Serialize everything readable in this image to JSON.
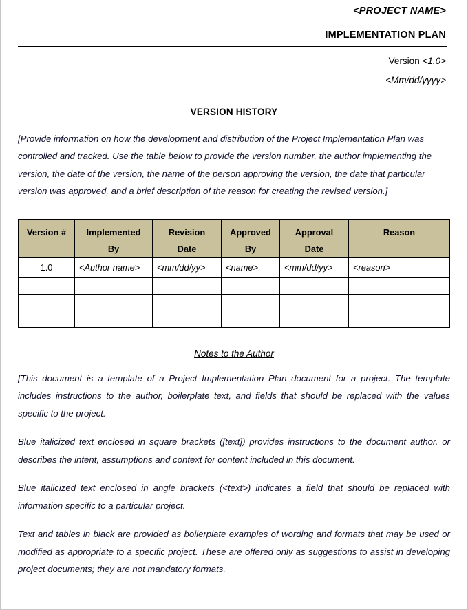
{
  "document": {
    "project_name": "<PROJECT NAME>",
    "title": "IMPLEMENTATION PLAN",
    "version_label": "Version ",
    "version_value": "<1.0>",
    "date": "<Mm/dd/yyyy>"
  },
  "version_history": {
    "heading": "VERSION HISTORY",
    "intro": "[Provide information on how the development and distribution of the Project Implementation Plan was controlled and tracked.  Use the table below to provide the version number, the author implementing the version, the date of the version, the name of the person approving the version, the date that particular version was approved, and a brief description of the reason for creating the revised version.]",
    "table": {
      "headers": [
        "Version #",
        "Implemented\nBy",
        "Revision\nDate",
        "Approved\nBy",
        "Approval\nDate",
        "Reason"
      ],
      "header_lines": [
        [
          "Version #",
          ""
        ],
        [
          "Implemented",
          "By"
        ],
        [
          "Revision",
          "Date"
        ],
        [
          "Approved",
          "By"
        ],
        [
          "Approval",
          "Date"
        ],
        [
          "Reason",
          ""
        ]
      ],
      "rows": [
        [
          "1.0",
          "<Author name>",
          "<mm/dd/yy>",
          "<name>",
          "<mm/dd/yy>",
          "<reason>"
        ],
        [
          "",
          "",
          "",
          "",
          "",
          ""
        ],
        [
          "",
          "",
          "",
          "",
          "",
          ""
        ],
        [
          "",
          "",
          "",
          "",
          "",
          ""
        ]
      ],
      "header_bg": "#c9c19c"
    }
  },
  "notes": {
    "heading": "Notes to the Author",
    "paragraphs": [
      "[This document is a template of a Project Implementation Plan document for a project. The template includes instructions to the author, boilerplate text, and fields that should be replaced with the values specific to the project.",
      "Blue italicized text enclosed in square brackets ([text]) provides instructions to the document author, or describes the intent, assumptions and context for content included in this document.",
      "Blue italicized text enclosed in angle brackets (<text>) indicates a field that should be replaced with information specific to a particular project.",
      "Text and tables in black are provided as boilerplate examples of wording and formats that may be used or modified as appropriate to a specific project. These are offered only as suggestions to assist in developing project documents; they are not mandatory formats."
    ]
  },
  "colors": {
    "page_border": "#c6c6c6",
    "text": "#0d0d2b",
    "heading": "#000000",
    "table_header_bg": "#c9c19c"
  }
}
